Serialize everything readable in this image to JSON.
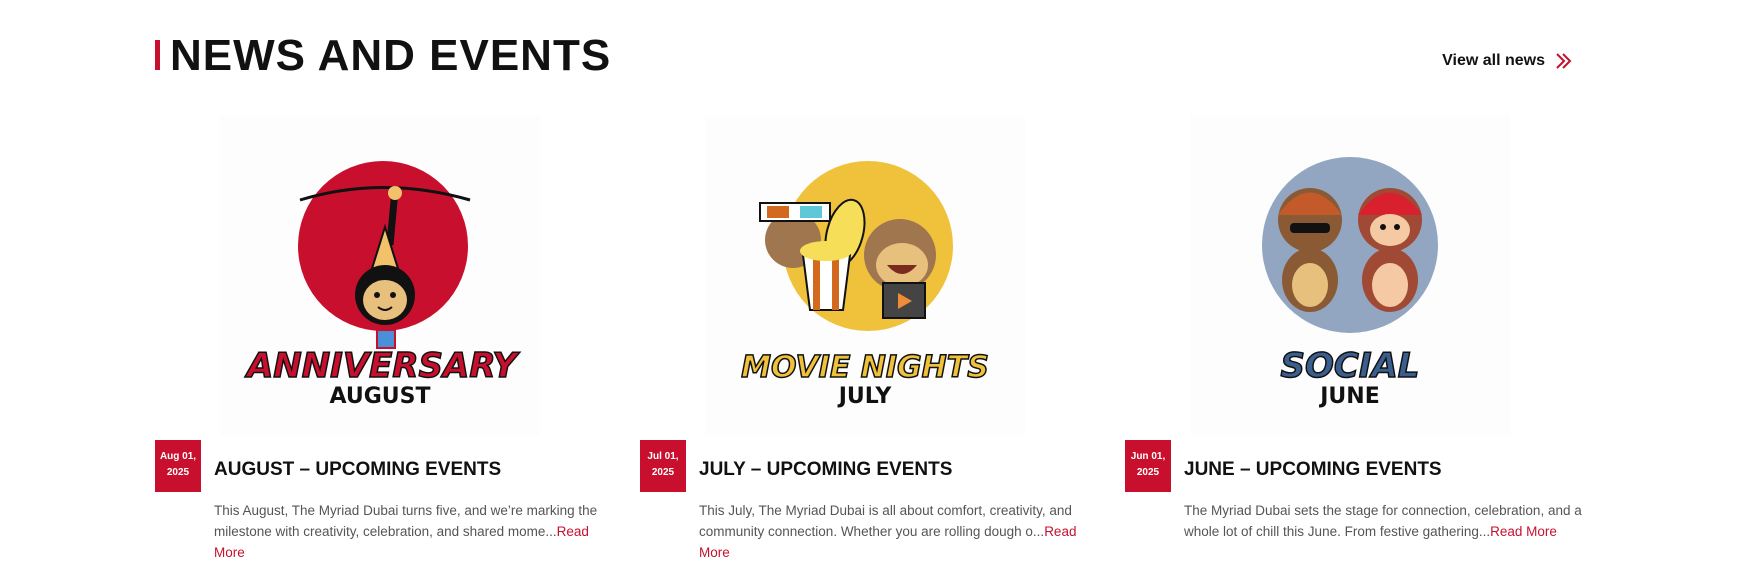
{
  "header": {
    "title": "NEWS AND EVENTS",
    "view_all_label": "View all news",
    "view_all_icon": "double-chevron-right-icon"
  },
  "colors": {
    "accent": "#c8102e",
    "text": "#111111",
    "muted_text": "#555555"
  },
  "cards": [
    {
      "date_line1": "Aug 01,",
      "date_line2": "2025",
      "title": "AUGUST – UPCOMING EVENTS",
      "description": "This August, The Myriad Dubai turns five, and we’re marking the milestone with creativity, celebration, and shared mome...",
      "read_more": "Read More",
      "image_script": "ANNIVERSARY",
      "image_caption": "AUGUST",
      "image_circle_color": "#c8102e"
    },
    {
      "date_line1": "Jul 01,",
      "date_line2": "2025",
      "title": "JULY – UPCOMING EVENTS",
      "description": "This July, The Myriad Dubai is all about comfort, creativity, and community connection. Whether you are rolling dough o...",
      "read_more": "Read More",
      "image_script": "MOVIE NIGHTS",
      "image_caption": "JULY",
      "image_circle_color": "#f0c23b"
    },
    {
      "date_line1": "Jun 01,",
      "date_line2": "2025",
      "title": "JUNE – UPCOMING EVENTS",
      "description": "The Myriad Dubai sets the stage for connection, celebration, and a whole lot of chill this June. From festive gathering...",
      "read_more": "Read More",
      "image_script": "SOCIAL",
      "image_caption": "JUNE",
      "image_circle_color": "#3a5f8f"
    }
  ]
}
